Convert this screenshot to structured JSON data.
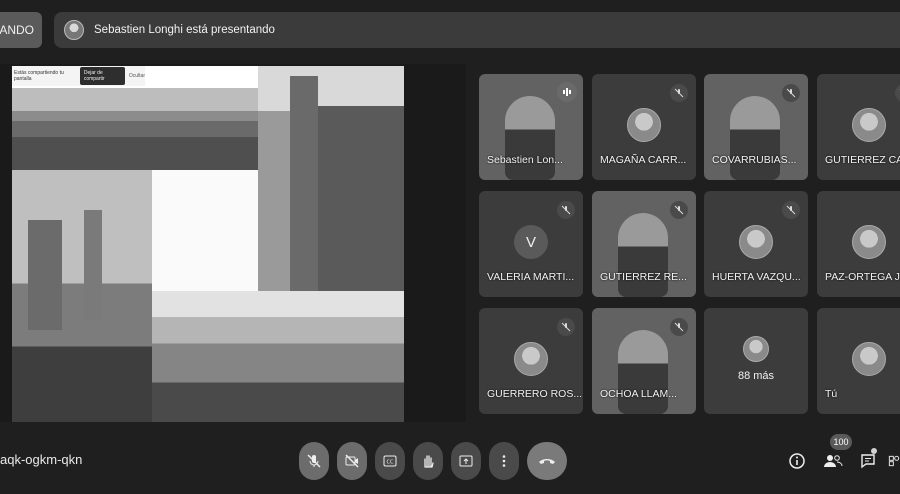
{
  "header": {
    "left_button_label": "RANDO",
    "presenting_text": "Sebastien Longhi está presentando"
  },
  "share_bar": {
    "sharing_text": "Estás compartiendo tu pantalla",
    "stop_label": "Dejar de compartir",
    "hide_label": "Ocultar"
  },
  "participants": [
    {
      "name": "Sebastien Lon...",
      "type": "video",
      "status": "speaking"
    },
    {
      "name": "MAGAÑA CARR...",
      "type": "avatar",
      "status": "muted"
    },
    {
      "name": "COVARRUBIAS...",
      "type": "video",
      "status": "muted"
    },
    {
      "name": "GUTIERREZ CA...",
      "type": "avatar",
      "status": "muted"
    },
    {
      "name": "VALERIA MARTI...",
      "type": "initial",
      "initial": "V",
      "status": "muted"
    },
    {
      "name": "GUTIERREZ RE...",
      "type": "video",
      "status": "muted"
    },
    {
      "name": "HUERTA VAZQU...",
      "type": "avatar",
      "status": "muted"
    },
    {
      "name": "PAZ-ORTEGA J...",
      "type": "avatar",
      "status": "none"
    },
    {
      "name": "GUERRERO ROS...",
      "type": "avatar",
      "status": "muted"
    },
    {
      "name": "OCHOA LLAM...",
      "type": "video",
      "status": "muted"
    },
    {
      "name": "88 más",
      "type": "more",
      "status": "none"
    },
    {
      "name": "Tú",
      "type": "avatar",
      "status": "none"
    }
  ],
  "footer": {
    "meeting_code": "aqk-ogkm-qkn",
    "participant_count": "100",
    "controls": [
      "mic-off-icon",
      "camera-off-icon",
      "captions-icon",
      "raise-hand-icon",
      "present-icon",
      "more-options-icon",
      "end-call-icon"
    ],
    "right_icons": [
      "info-icon",
      "people-icon",
      "chat-icon",
      "activities-icon"
    ]
  },
  "colors": {
    "background": "#1f1f1f",
    "tile": "#3c3c3c",
    "banner": "#3b3b3b",
    "control": "#4a4a4a"
  }
}
